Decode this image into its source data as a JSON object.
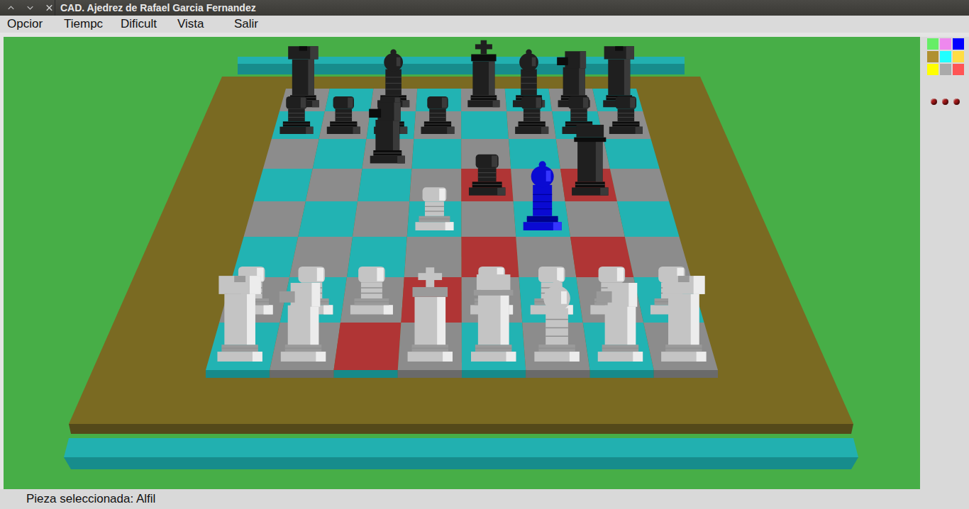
{
  "window": {
    "title": "CAD. Ajedrez de Rafael Garcia Fernandez"
  },
  "menu": [
    "Opcior",
    "Tiempc",
    "Dificult",
    "Vista",
    "Salir"
  ],
  "board": {
    "highlighted": [
      "e5",
      "g5",
      "e3",
      "g3",
      "d2",
      "c1"
    ],
    "pieces": [
      {
        "square": "a8",
        "type": "rook",
        "side": "black",
        "selected": false
      },
      {
        "square": "c8",
        "type": "bishop",
        "side": "black",
        "selected": false
      },
      {
        "square": "e8",
        "type": "king",
        "side": "black",
        "selected": false
      },
      {
        "square": "f8",
        "type": "bishop",
        "side": "black",
        "selected": false
      },
      {
        "square": "g8",
        "type": "knight",
        "side": "black",
        "selected": false
      },
      {
        "square": "h8",
        "type": "rook",
        "side": "black",
        "selected": false
      },
      {
        "square": "a7",
        "type": "pawn",
        "side": "black",
        "selected": false
      },
      {
        "square": "b7",
        "type": "pawn",
        "side": "black",
        "selected": false
      },
      {
        "square": "c7",
        "type": "pawn",
        "side": "black",
        "selected": false
      },
      {
        "square": "d7",
        "type": "pawn",
        "side": "black",
        "selected": false
      },
      {
        "square": "f7",
        "type": "pawn",
        "side": "black",
        "selected": false
      },
      {
        "square": "g7",
        "type": "pawn",
        "side": "black",
        "selected": false
      },
      {
        "square": "h7",
        "type": "pawn",
        "side": "black",
        "selected": false
      },
      {
        "square": "c6",
        "type": "knight",
        "side": "black",
        "selected": false
      },
      {
        "square": "e5",
        "type": "pawn",
        "side": "black",
        "selected": false
      },
      {
        "square": "g5",
        "type": "queen",
        "side": "black",
        "selected": false
      },
      {
        "square": "d4",
        "type": "pawn",
        "side": "white",
        "selected": false
      },
      {
        "square": "f4",
        "type": "bishop",
        "side": "white",
        "selected": true
      },
      {
        "square": "a2",
        "type": "pawn",
        "side": "white",
        "selected": false
      },
      {
        "square": "b2",
        "type": "pawn",
        "side": "white",
        "selected": false
      },
      {
        "square": "c2",
        "type": "pawn",
        "side": "white",
        "selected": false
      },
      {
        "square": "e2",
        "type": "pawn",
        "side": "white",
        "selected": false
      },
      {
        "square": "f2",
        "type": "pawn",
        "side": "white",
        "selected": false
      },
      {
        "square": "g2",
        "type": "pawn",
        "side": "white",
        "selected": false
      },
      {
        "square": "h2",
        "type": "pawn",
        "side": "white",
        "selected": false
      },
      {
        "square": "a1",
        "type": "rook",
        "side": "white",
        "selected": false
      },
      {
        "square": "b1",
        "type": "knight",
        "side": "white",
        "selected": false
      },
      {
        "square": "d1",
        "type": "king",
        "side": "white",
        "selected": false
      },
      {
        "square": "e1",
        "type": "queen",
        "side": "white",
        "selected": false
      },
      {
        "square": "f1",
        "type": "bishop",
        "side": "white",
        "selected": false
      },
      {
        "square": "g1",
        "type": "knight",
        "side": "white",
        "selected": false
      },
      {
        "square": "h1",
        "type": "rook",
        "side": "white",
        "selected": false
      }
    ]
  },
  "palette": [
    {
      "color": "#66ee66"
    },
    {
      "color": "#ee88ee"
    },
    {
      "color": "#0000ff"
    },
    {
      "color": "#b09030"
    },
    {
      "color": "#22ffff"
    },
    {
      "color": "#ffdd44"
    },
    {
      "color": "#ffff00"
    },
    {
      "color": "#aaaaaa"
    },
    {
      "color": "#ff5555"
    }
  ],
  "indicators": [
    {
      "color": "#a01818"
    },
    {
      "color": "#a01818"
    },
    {
      "color": "#a01818"
    }
  ],
  "status_bar": "Pieza seleccionada: Alfil"
}
